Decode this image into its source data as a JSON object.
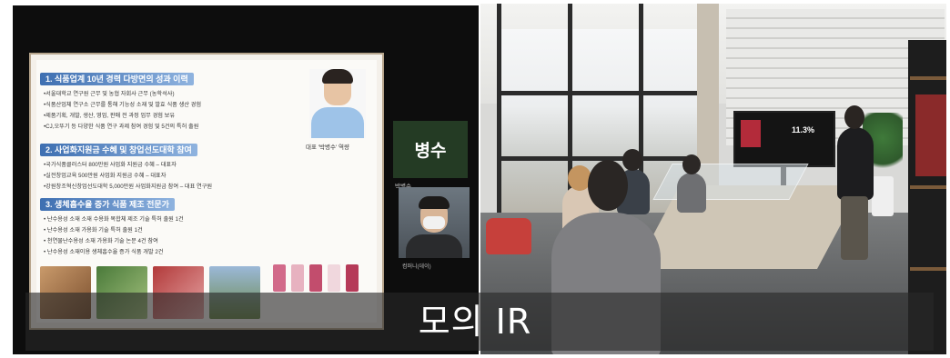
{
  "slide": {
    "section1_title": "1. 식품업계 10년 경력 다방면의 성과 이력",
    "section1_items": [
      "•서울대학교 연구원 근무 및 농협 자회사 근무 (농학석사)",
      "•식품산업체 연구소 근무를 통해 기능성 소재 및 발효 식품 생산 경험",
      "•제품기획, 개발, 생산, 영업, 판매 전 과정 업무 경험 보유",
      "•CJ,오뚜기 등 다양한 식품 연구 과제 참여 경험 및 5건의 특허 출원"
    ],
    "portrait_caption": "대표 '박병수' 역량",
    "section2_title": "2. 사업화지원금 수혜 및 창업선도대학 참여",
    "section2_items": [
      "•국가식품클러스터 800만원 사업화 지원금 수혜 – 대표자",
      "•실전창업교육 500만원 사업화 지원금 수혜 – 대표자",
      "•강원창조혁신창업선도대학 5,000만원 사업화지원금 참여 – 대표 연구원"
    ],
    "section3_title": "3. 생체흡수율 증가 식품 제조 전문가",
    "section3_items": [
      "• 난수용성 소재 소재 수용화 복합체 제조 기술 특허 출원 1건",
      "• 난수용성 소재 가용화 기술 특허 출원 1건",
      "• 천연물난수용성 소재 가용화 기술 논문 4건 참여",
      "• 난수용성 소재이용 생체흡수율 증가 식품 개발 2건"
    ]
  },
  "participants": {
    "name_tile_text": "병수",
    "name_tile_label": "박병수",
    "video_label": "컴퍼니(데이)"
  },
  "photo": {
    "tv_text": "11.3%"
  },
  "caption": "모의 IR",
  "colors": {
    "section_title": "#3e6fb1",
    "highlight": "#c41e1e",
    "name_tile_bg": "#243b24"
  }
}
